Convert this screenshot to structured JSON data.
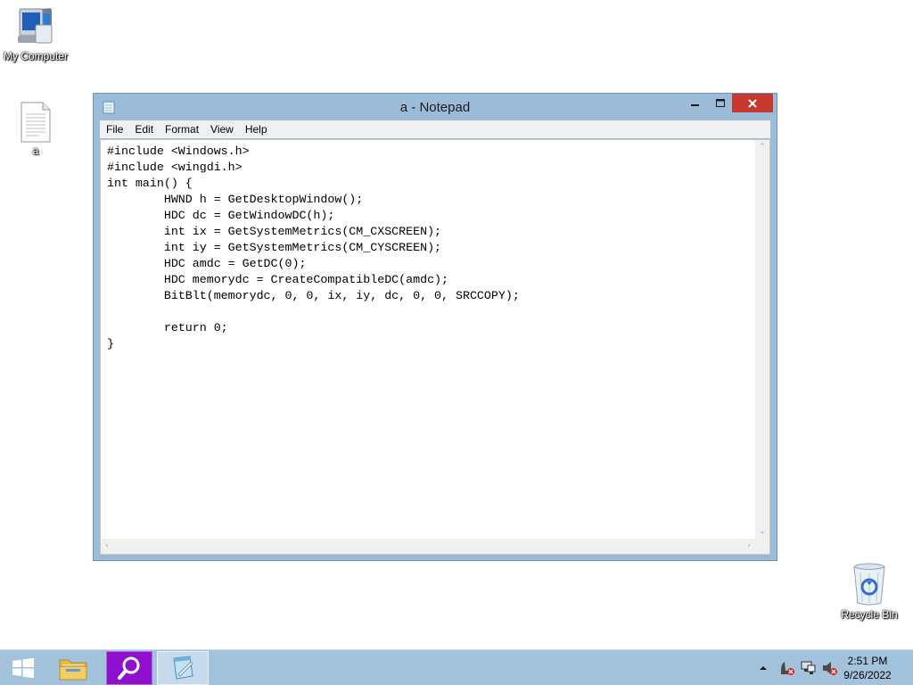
{
  "desktop": {
    "icons": [
      {
        "label": "My Computer"
      },
      {
        "label": "a"
      },
      {
        "label": "Recycle Bin"
      }
    ]
  },
  "window": {
    "title": "a - Notepad",
    "menu": [
      "File",
      "Edit",
      "Format",
      "View",
      "Help"
    ],
    "content": "#include <Windows.h>\n#include <wingdi.h>\nint main() {\n        HWND h = GetDesktopWindow();\n        HDC dc = GetWindowDC(h);\n        int ix = GetSystemMetrics(CM_CXSCREEN);\n        int iy = GetSystemMetrics(CM_CYSCREEN);\n        HDC amdc = GetDC(0);\n        HDC memorydc = CreateCompatibleDC(amdc);\n        BitBlt(memorydc, 0, 0, ix, iy, dc, 0, 0, SRCCOPY);\n\n        return 0;\n}"
  },
  "taskbar": {
    "clock_time": "2:51 PM",
    "clock_date": "9/26/2022",
    "accent_color": "#8f0fcf"
  }
}
